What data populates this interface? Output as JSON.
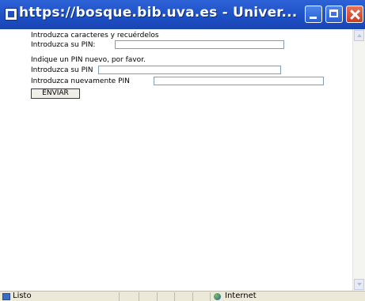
{
  "window": {
    "title": "https://bosque.bib.uva.es - Univer..."
  },
  "form": {
    "intro_line": "Introduzca caracteres y recuérdelos",
    "pin_label": "Introduzca su PIN:",
    "pin_value": "",
    "new_pin_prompt": "Indique un PIN nuevo, por favor.",
    "new_pin_label": "Introduzca su PIN",
    "new_pin_value": "",
    "confirm_pin_label": "Introduzca nuevamente PIN",
    "confirm_pin_value": "",
    "submit_label": "ENVIAR"
  },
  "status": {
    "text": "Listo",
    "zone": "Internet"
  }
}
